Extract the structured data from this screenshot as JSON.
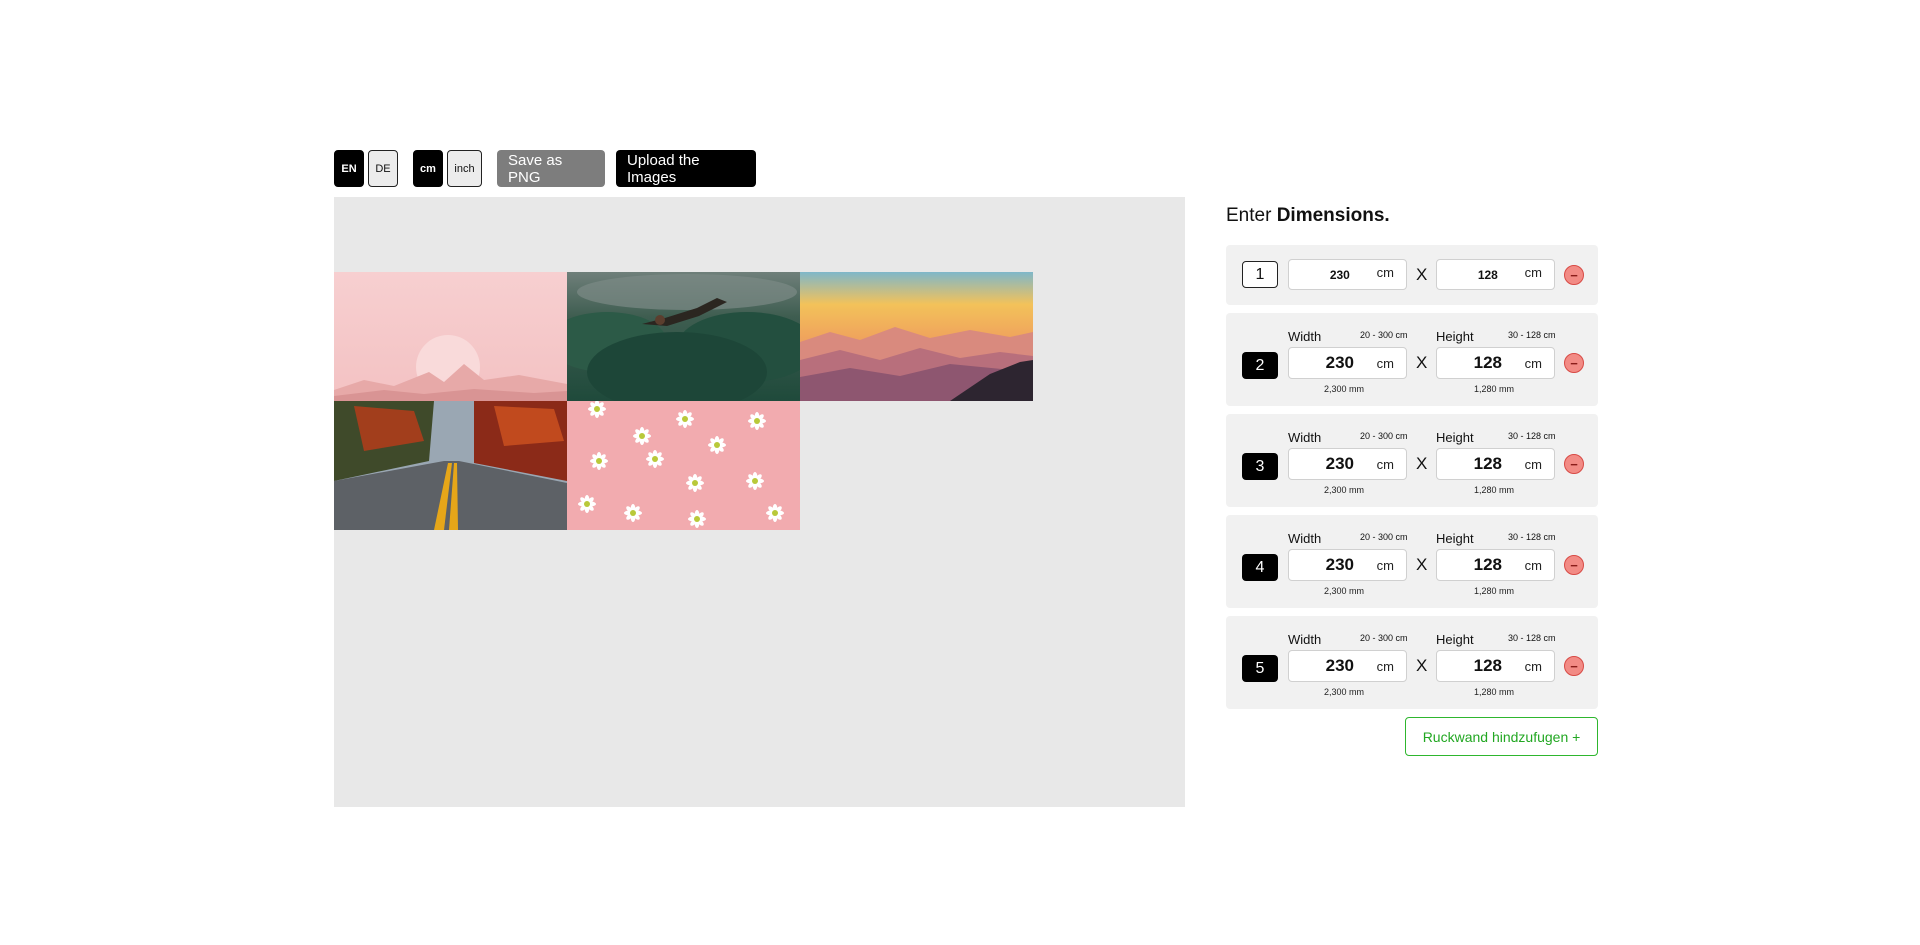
{
  "toolbar": {
    "lang_en": "EN",
    "lang_de": "DE",
    "unit_cm": "cm",
    "unit_inch": "inch",
    "save_png": "Save as PNG",
    "upload": "Upload the Images"
  },
  "panel": {
    "title_prefix": "Enter",
    "title_bold": "Dimensions.",
    "add_button": "Ruckwand hindzufugen +",
    "x_separator": "X",
    "remove_symbol": "−",
    "width_label": "Width",
    "height_label": "Height",
    "width_range": "20 - 300 cm",
    "height_range": "30 - 128 cm"
  },
  "rows": [
    {
      "num": "1",
      "width": "230",
      "height": "128",
      "width_unit": "cm",
      "height_unit": "cm"
    },
    {
      "num": "2",
      "width": "230",
      "height": "128",
      "width_unit": "cm",
      "height_unit": "cm",
      "width_mm": "2,300 mm",
      "height_mm": "1,280 mm"
    },
    {
      "num": "3",
      "width": "230",
      "height": "128",
      "width_unit": "cm",
      "height_unit": "cm",
      "width_mm": "2,300 mm",
      "height_mm": "1,280 mm"
    },
    {
      "num": "4",
      "width": "230",
      "height": "128",
      "width_unit": "cm",
      "height_unit": "cm",
      "width_mm": "2,300 mm",
      "height_mm": "1,280 mm"
    },
    {
      "num": "5",
      "width": "230",
      "height": "128",
      "width_unit": "cm",
      "height_unit": "cm",
      "width_mm": "2,300 mm",
      "height_mm": "1,280 mm"
    }
  ],
  "images": [
    "pink-moon-landscape",
    "green-forest-fog",
    "sunset-mountains",
    "autumn-road",
    "pink-daisies"
  ]
}
